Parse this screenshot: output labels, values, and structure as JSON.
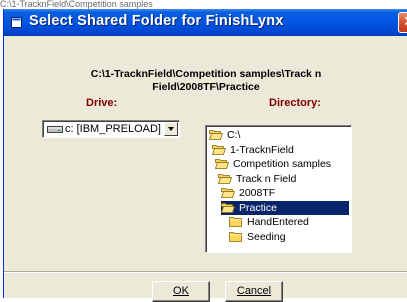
{
  "background": {
    "text": "C:\\1-TracknField\\Competition samples"
  },
  "dialog": {
    "title": "Select Shared Folder for FinishLynx",
    "current_path": "C:\\1-TracknField\\Competition samples\\Track n Field\\2008TF\\Practice",
    "drive_label": "Drive:",
    "directory_label": "Directory:",
    "drive": {
      "selected": "c: [IBM_PRELOAD]"
    },
    "directories": [
      {
        "name": "C:\\",
        "state": "open"
      },
      {
        "name": "1-TracknField",
        "state": "open"
      },
      {
        "name": "Competition samples",
        "state": "open"
      },
      {
        "name": "Track n Field",
        "state": "open"
      },
      {
        "name": "2008TF",
        "state": "open"
      },
      {
        "name": "Practice",
        "state": "open",
        "selected": true
      },
      {
        "name": "HandEntered",
        "state": "closed"
      },
      {
        "name": "Seeding",
        "state": "closed"
      }
    ],
    "ok_label": "OK",
    "cancel_label": "Cancel"
  },
  "colors": {
    "title_bar": "#0054e3",
    "label_red": "#800000",
    "selection": "#0a246a",
    "dialog_bg": "#ece9d8"
  }
}
